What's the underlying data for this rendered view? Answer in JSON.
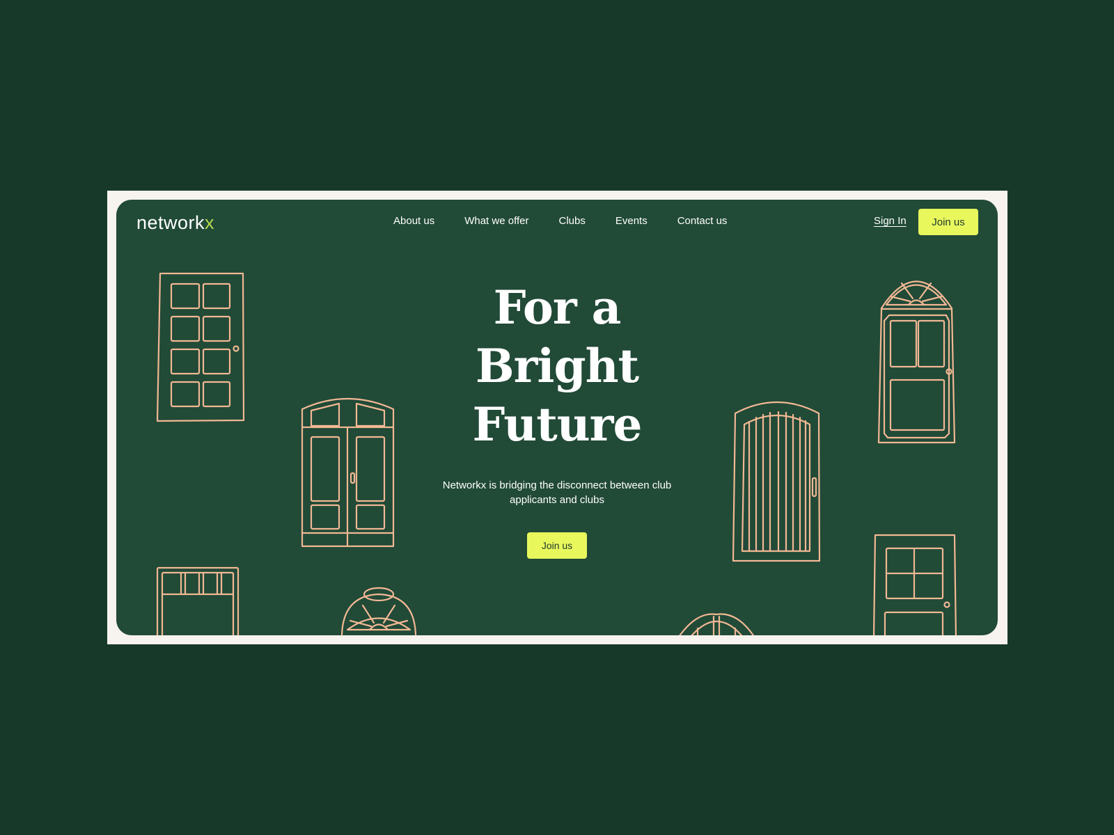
{
  "brand": {
    "logo_main": "network",
    "logo_accent": "x",
    "accent_color": "#e8f75c",
    "background_color": "#214a37",
    "illustration_color": "#f2b894"
  },
  "nav": {
    "items": [
      {
        "label": "About us"
      },
      {
        "label": "What we offer"
      },
      {
        "label": "Clubs"
      },
      {
        "label": "Events"
      },
      {
        "label": "Contact us"
      }
    ],
    "sign_in": "Sign In",
    "join": "Join us"
  },
  "hero": {
    "headline_lines": [
      "For a",
      "Bright",
      "Future"
    ],
    "subtitle": "Networkx is bridging the disconnect between club applicants and clubs",
    "cta": "Join us"
  },
  "illustrations": [
    {
      "name": "door-eight-panel"
    },
    {
      "name": "door-double-arched"
    },
    {
      "name": "door-planked-arched"
    },
    {
      "name": "door-fanlight"
    },
    {
      "name": "door-transom"
    },
    {
      "name": "door-fanlight-small"
    },
    {
      "name": "door-arched-bottom"
    },
    {
      "name": "door-four-pane"
    }
  ]
}
